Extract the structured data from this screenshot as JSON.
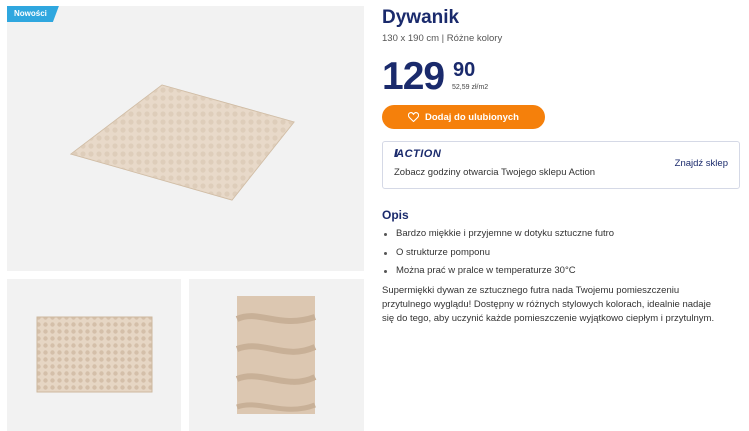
{
  "badge": "Nowości",
  "product": {
    "title": "Dywanik",
    "subtitle": "130 x 190 cm | Różne kolory",
    "price_int": "129",
    "price_dec": "90",
    "unit_price": "52,59 zł/m2"
  },
  "favorite_button": {
    "label": "Dodaj do ulubionych",
    "icon": "heart-icon"
  },
  "store": {
    "logo": "ACTION",
    "text": "Zobacz godziny otwarcia Twojego sklepu Action",
    "link": "Znajdź sklep"
  },
  "description": {
    "heading": "Opis",
    "bullets": [
      "Bardzo miękkie i przyjemne w dotyku sztuczne futro",
      "O strukturze pomponu",
      "Można prać w pralce w temperaturze 30°C"
    ],
    "text": "Supermiękki dywan ze sztucznego futra nada Twojemu pomieszczeniu przytulnego wyglądu! Dostępny w różnych stylowych kolorach, idealnie nadaje się do tego, aby uczynić każde pomieszczenie wyjątkowo ciepłym i przytulnym."
  },
  "colors": {
    "navy": "#1a2a6c",
    "orange": "#f5800b",
    "badge_blue": "#2fa7df",
    "rug": "#e3d2c0"
  }
}
